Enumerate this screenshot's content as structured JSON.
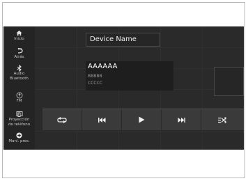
{
  "header": {
    "device_name": "Device Name"
  },
  "sidebar": {
    "items": [
      {
        "label": "Inicio",
        "icon": "home-icon"
      },
      {
        "label": "Atrás",
        "icon": "back-icon"
      },
      {
        "label": "Audio Bluetooth",
        "line1": "Audio",
        "line2": "Bluetooth",
        "icon": "bluetooth-icon"
      },
      {
        "label": "FM",
        "icon": "radio-icon"
      },
      {
        "label": "Proyección de teléfono",
        "line1": "Proyección",
        "line2": "de teléfono",
        "icon": "phone-projection-icon"
      },
      {
        "label": "Manl. pres.",
        "icon": "plus-icon"
      }
    ]
  },
  "track": {
    "title": "AAAAAA",
    "artist": "BBBBB",
    "album": "CCCCC"
  },
  "controls": [
    {
      "icon": "repeat-icon"
    },
    {
      "icon": "previous-track-icon"
    },
    {
      "icon": "play-icon"
    },
    {
      "icon": "next-track-icon"
    },
    {
      "icon": "shuffle-icon"
    }
  ],
  "colors": {
    "screen_bg": "#2a2a2a",
    "control_bar_bg": "#3a3a3a",
    "text_primary": "#f0f0f0",
    "text_secondary": "#9a9a9a"
  }
}
